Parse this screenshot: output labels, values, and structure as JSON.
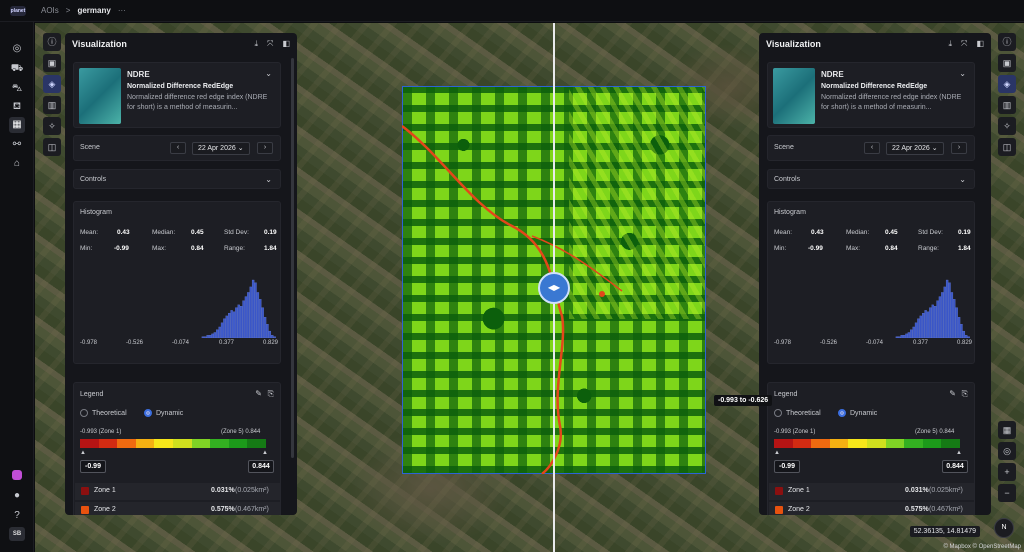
{
  "topbar": {
    "logo": "planet",
    "crumb_root": "AOIs",
    "crumb_sep": ">",
    "crumb_current": "germany",
    "more": "···"
  },
  "leftnav": {
    "avatar": "SB"
  },
  "left_panel": {
    "title": "Visualization",
    "index": {
      "name": "NDRE",
      "full_name": "Normalized Difference RedEdge",
      "description": "Normalized difference red edge index (NDRE for short) is a method of measurin..."
    },
    "scene": {
      "label": "Scene",
      "date": "22 Apr 2026"
    },
    "controls": {
      "label": "Controls"
    },
    "histogram": {
      "label": "Histogram",
      "stats": {
        "mean_label": "Mean:",
        "mean": "0.43",
        "median_label": "Median:",
        "median": "0.45",
        "std_label": "Std Dev:",
        "std": "0.19",
        "min_label": "Min:",
        "min": "-0.99",
        "max_label": "Max:",
        "max": "0.84",
        "range_label": "Range:",
        "range": "1.84"
      },
      "ticks": [
        "-0.978",
        "-0.526",
        "-0.074",
        "0.377",
        "0.829"
      ]
    },
    "legend": {
      "label": "Legend",
      "theoretical": "Theoretical",
      "dynamic": "Dynamic",
      "zone_min_label": "-0.993 (Zone 1)",
      "zone_max_label": "(Zone 5) 0.844",
      "min_value": "-0.99",
      "max_value": "0.844",
      "zones": [
        {
          "name": "Zone 1",
          "pct": "0.031%",
          "area": "(0.025km²)",
          "color": "#8b1010"
        },
        {
          "name": "Zone 2",
          "pct": "0.575%",
          "area": "(0.467km²)",
          "color": "#e8520f"
        }
      ]
    }
  },
  "right_panel": {
    "title": "Visualization",
    "index": {
      "name": "NDRE",
      "full_name": "Normalized Difference RedEdge",
      "description": "Normalized difference red edge index (NDRE for short) is a method of measurin..."
    },
    "scene": {
      "label": "Scene",
      "date": "22 Apr 2026"
    },
    "controls": {
      "label": "Controls"
    },
    "histogram": {
      "label": "Histogram",
      "stats": {
        "mean_label": "Mean:",
        "mean": "0.43",
        "median_label": "Median:",
        "median": "0.45",
        "std_label": "Std Dev:",
        "std": "0.19",
        "min_label": "Min:",
        "min": "-0.99",
        "max_label": "Max:",
        "max": "0.84",
        "range_label": "Range:",
        "range": "1.84"
      },
      "ticks": [
        "-0.978",
        "-0.526",
        "-0.074",
        "0.377",
        "0.829"
      ]
    },
    "legend": {
      "label": "Legend",
      "theoretical": "Theoretical",
      "dynamic": "Dynamic",
      "zone_min_label": "-0.993 (Zone 1)",
      "zone_max_label": "(Zone 5) 0.844",
      "min_value": "-0.99",
      "max_value": "0.844",
      "zones": [
        {
          "name": "Zone 1",
          "pct": "0.031%",
          "area": "(0.025km²)",
          "color": "#8b1010"
        },
        {
          "name": "Zone 2",
          "pct": "0.575%",
          "area": "(0.467km²)",
          "color": "#e8520f"
        }
      ]
    }
  },
  "map": {
    "tooltip": "-0.993 to -0.626",
    "coords": "52.36135, 14.81479",
    "compass": "N",
    "attribution": "© Mapbox © OpenStreetMap"
  },
  "ramp_colors": [
    "#b51414",
    "#d22b12",
    "#ef6a10",
    "#f4b012",
    "#f6e61a",
    "#cfe01e",
    "#7fd325",
    "#33b021",
    "#1c9a1a",
    "#157a15"
  ],
  "histogram_bins": [
    0,
    0,
    0,
    0,
    0,
    0,
    0,
    0,
    0,
    0,
    0,
    0,
    0,
    0,
    0,
    0,
    0,
    0,
    0,
    0,
    0,
    0,
    0,
    0,
    0,
    0,
    0,
    0,
    0,
    0,
    0,
    0,
    0,
    0,
    0,
    0,
    0,
    0,
    0,
    0,
    0,
    0,
    0,
    0,
    0,
    0,
    0,
    0,
    0,
    0,
    0,
    1,
    1,
    2,
    2,
    3,
    4,
    6,
    8,
    11,
    14,
    16,
    18,
    20,
    19,
    22,
    24,
    23,
    27,
    30,
    33,
    37,
    42,
    40,
    33,
    28,
    22,
    15,
    10,
    5,
    2,
    1
  ]
}
